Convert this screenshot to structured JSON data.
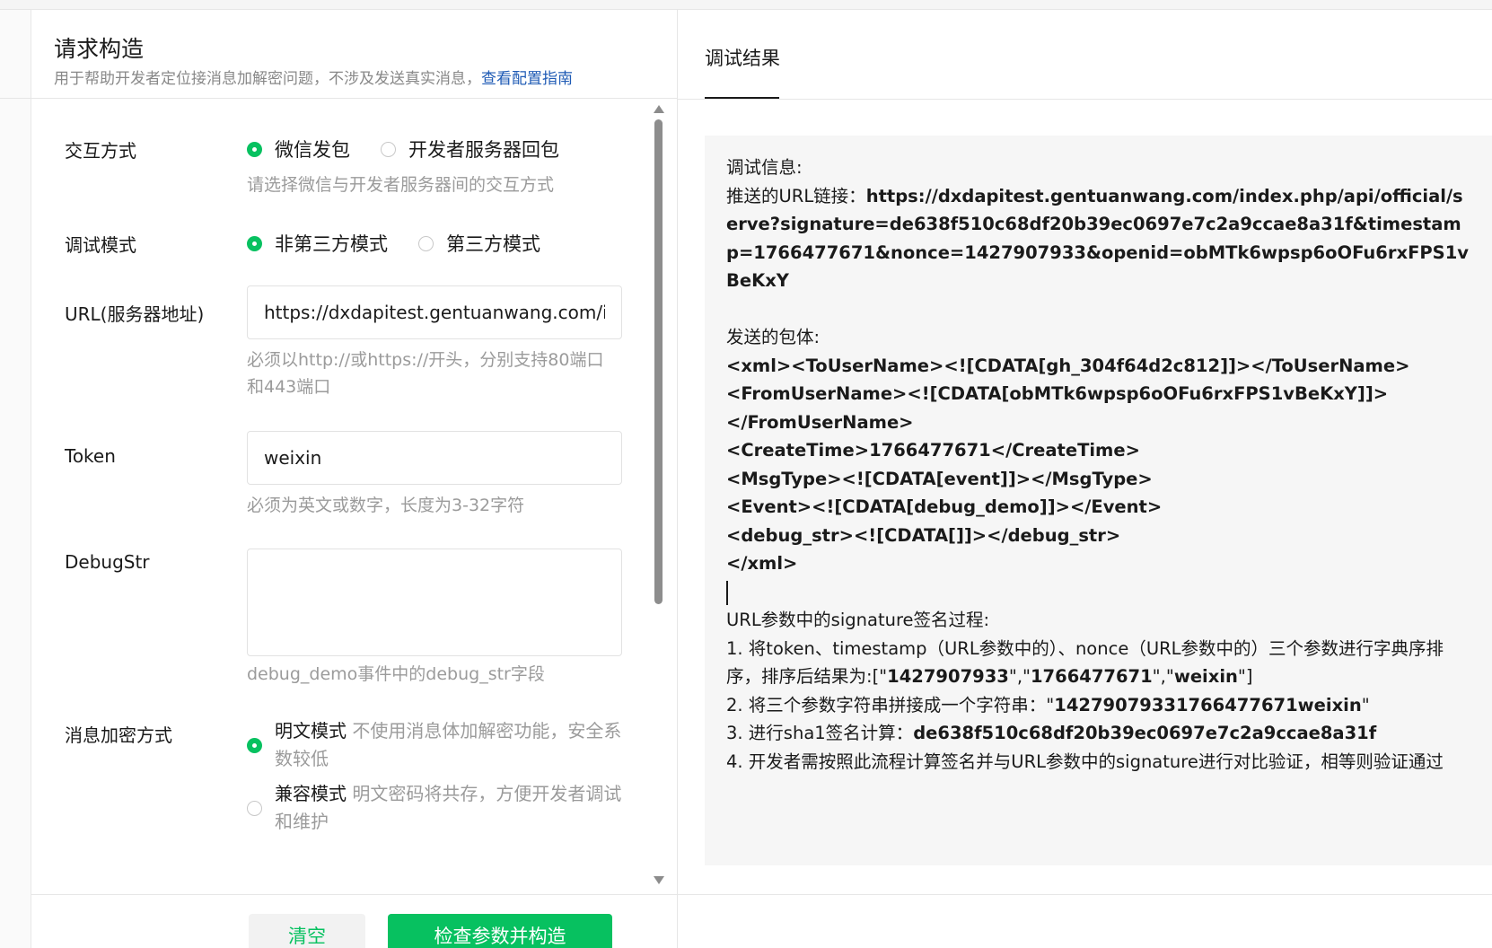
{
  "left": {
    "title": "请求构造",
    "description": "用于帮助开发者定位接消息加解密问题，不涉及发送真实消息，",
    "guide_link": "查看配置指南",
    "interaction": {
      "label": "交互方式",
      "options": [
        "微信发包",
        "开发者服务器回包"
      ],
      "selected": "微信发包",
      "hint": "请选择微信与开发者服务器间的交互方式"
    },
    "debug_mode": {
      "label": "调试模式",
      "options": [
        "非第三方模式",
        "第三方模式"
      ],
      "selected": "非第三方模式"
    },
    "url": {
      "label": "URL(服务器地址)",
      "value": "https://dxdapitest.gentuanwang.com/index.php/api/official/serve",
      "hint": "必须以http://或https://开头，分别支持80端口和443端口"
    },
    "token": {
      "label": "Token",
      "value": "weixin",
      "hint": "必须为英文或数字，长度为3-32字符"
    },
    "debugstr": {
      "label": "DebugStr",
      "value": "",
      "hint": "debug_demo事件中的debug_str字段"
    },
    "encryption": {
      "label": "消息加密方式",
      "options": [
        {
          "name": "明文模式",
          "desc": "不使用消息体加解密功能，安全系数较低"
        },
        {
          "name": "兼容模式",
          "desc": "明文密码将共存，方便开发者调试和维护"
        }
      ],
      "selected": "明文模式"
    },
    "buttons": {
      "clear": "清空",
      "submit": "检查参数并构造"
    }
  },
  "right": {
    "tab": "调试结果",
    "debug_info_label": "调试信息:",
    "url_label": "推送的URL链接：",
    "url_value": "https://dxdapitest.gentuanwang.com/index.php/api/official/serve?signature=de638f510c68df20b39ec0697e7c2a9ccae8a31f&timestamp=1766477671&nonce=1427907933&openid=obMTk6wpsp6oOFu6rxFPS1vBeKxY",
    "body_label": "发送的包体:",
    "xml_lines": [
      "<xml><ToUserName><![CDATA[gh_304f64d2c812]]></ToUserName>",
      "<FromUserName><![CDATA[obMTk6wpsp6oOFu6rxFPS1vBeKxY]]>",
      "</FromUserName>",
      "<CreateTime>1766477671</CreateTime>",
      "<MsgType><![CDATA[event]]></MsgType>",
      "<Event><![CDATA[debug_demo]]></Event>",
      "<debug_str><![CDATA[]]></debug_str>",
      "</xml>"
    ],
    "sig_title": "URL参数中的signature签名过程:",
    "step1_prefix": "1. 将token、timestamp（URL参数中的）、nonce（URL参数中的）三个参数进行字典序排序，排序后结果为:[\"",
    "step1_v1": "1427907933",
    "step1_sep1": "\",\"",
    "step1_v2": "1766477671",
    "step1_sep2": "\",\"",
    "step1_v3": "weixin",
    "step1_suffix": "\"]",
    "step2_prefix": "2. 将三个参数字符串拼接成一个字符串：\"",
    "step2_value": "14279079331766477671weixin",
    "step2_suffix": "\"",
    "step3_prefix": "3. 进行sha1签名计算：",
    "step3_value": "de638f510c68df20b39ec0697e7c2a9ccae8a31f",
    "step4": "4. 开发者需按照此流程计算签名并与URL参数中的signature进行对比验证，相等则验证通过"
  }
}
